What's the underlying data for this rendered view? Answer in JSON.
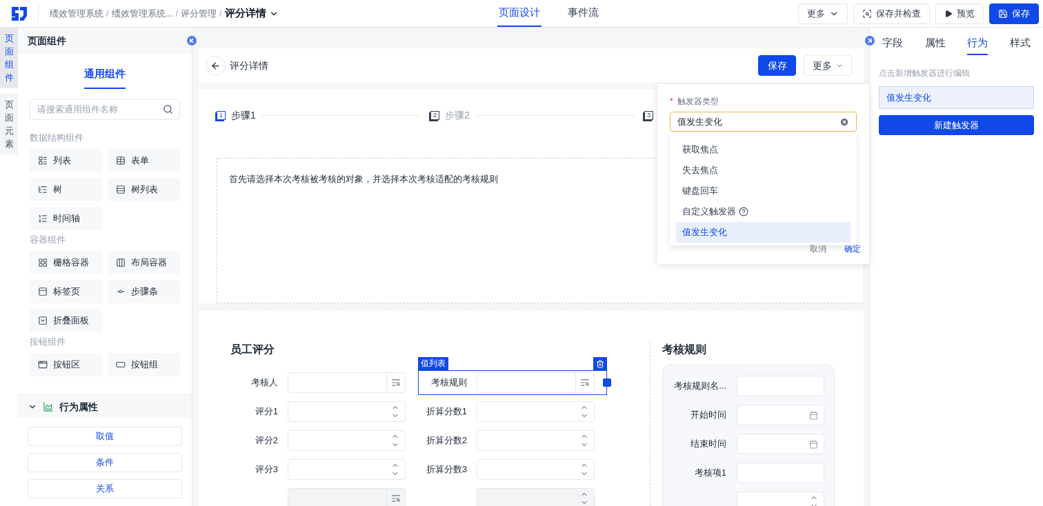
{
  "header": {
    "breadcrumb": [
      "绩效管理系统",
      "绩效管理系统...",
      "评分管理"
    ],
    "separator": "/",
    "current": "评分详情",
    "tabs": [
      {
        "label": "页面设计",
        "selected": true
      },
      {
        "label": "事件流",
        "selected": false
      }
    ],
    "actions": [
      {
        "label": "更多",
        "kind": "dropdown"
      },
      {
        "label": "保存并检查",
        "kind": "check"
      },
      {
        "label": "预览",
        "kind": "preview"
      },
      {
        "label": "保存",
        "kind": "primary"
      }
    ]
  },
  "side_tabs": [
    {
      "label": "页面组件",
      "selected": true
    },
    {
      "label": "页面元素",
      "selected": false
    }
  ],
  "component_panel": {
    "title": "页面组件",
    "tab": "通用组件",
    "search_placeholder": "请搜索通用组件名称",
    "groups": [
      {
        "title": "数据结构组件",
        "items": [
          {
            "label": "列表",
            "kind": "list"
          },
          {
            "label": "表单",
            "kind": "form"
          },
          {
            "label": "树",
            "kind": "tree"
          },
          {
            "label": "树列表",
            "kind": "treelist"
          },
          {
            "label": "时间轴",
            "kind": "timeline"
          }
        ]
      },
      {
        "title": "容器组件",
        "items": [
          {
            "label": "栅格容器",
            "kind": "grid"
          },
          {
            "label": "布局容器",
            "kind": "layout"
          },
          {
            "label": "标签页",
            "kind": "tabs"
          },
          {
            "label": "步骤条",
            "kind": "steps"
          },
          {
            "label": "折叠面板",
            "kind": "collapse"
          }
        ]
      },
      {
        "title": "按钮组件",
        "items": [
          {
            "label": "按钮区",
            "kind": "buttonarea"
          },
          {
            "label": "按钮组",
            "kind": "buttongroup"
          }
        ]
      }
    ]
  },
  "behavior": {
    "title": "行为属性",
    "expanded": true,
    "buttons": [
      "取值",
      "条件",
      "关系"
    ]
  },
  "canvas": {
    "title": "评分详情",
    "buttons": [
      {
        "label": "保存",
        "kind": "primary"
      },
      {
        "label": "更多",
        "kind": "dropdown"
      }
    ],
    "steps": [
      {
        "number": "1",
        "label": "步骤1",
        "selected": true
      },
      {
        "number": "2",
        "label": "步骤2",
        "selected": false
      },
      {
        "number": "3",
        "selected": false
      }
    ],
    "instruction": "首先请选择本次考核被考核的对象，并选择本次考核适配的考核规则",
    "form": {
      "title": "员工评分",
      "selection_tag": "值列表",
      "fields": [
        {
          "label": "考核人",
          "kind": "lookup",
          "selected": false,
          "disabled": false
        },
        {
          "label": "考核规则",
          "kind": "lookup",
          "selected": true,
          "disabled": false
        },
        {
          "label": "评分1",
          "kind": "number",
          "selected": false,
          "disabled": false
        },
        {
          "label": "折算分数1",
          "kind": "number",
          "selected": false,
          "disabled": false
        },
        {
          "label": "评分2",
          "kind": "number",
          "selected": false,
          "disabled": false
        },
        {
          "label": "折算分数2",
          "kind": "number",
          "selected": false,
          "disabled": false
        },
        {
          "label": "评分3",
          "kind": "number",
          "selected": false,
          "disabled": false
        },
        {
          "label": "折算分数3",
          "kind": "number",
          "selected": false,
          "disabled": false
        },
        {
          "kind": "lookup",
          "selected": false,
          "disabled": true
        },
        {
          "kind": "number",
          "selected": false,
          "disabled": true
        }
      ]
    },
    "rule": {
      "title": "考核规则",
      "fields": [
        {
          "label": "考核规则名...",
          "kind": "text"
        },
        {
          "label": "开始时间",
          "kind": "date"
        },
        {
          "label": "结束时间",
          "kind": "date"
        },
        {
          "label": "考核项1",
          "kind": "text"
        },
        {
          "kind": "number"
        }
      ]
    }
  },
  "trigger_popover": {
    "required_mark": "*",
    "label": "触发器类型",
    "value": "值发生变化",
    "options": [
      {
        "label": "获取焦点",
        "selected": false,
        "help": false
      },
      {
        "label": "失去焦点",
        "selected": false,
        "help": false
      },
      {
        "label": "键盘回车",
        "selected": false,
        "help": false
      },
      {
        "label": "自定义触发器",
        "selected": false,
        "help": true
      },
      {
        "label": "值发生变化",
        "selected": true,
        "help": false
      }
    ],
    "cancel": "取消",
    "confirm": "确定"
  },
  "right_panel": {
    "tabs": [
      {
        "label": "字段",
        "selected": false
      },
      {
        "label": "属性",
        "selected": false
      },
      {
        "label": "行为",
        "selected": true
      },
      {
        "label": "样式",
        "selected": false
      }
    ],
    "hint": "点击新增触发器进行编辑",
    "triggers": [
      {
        "label": "值发生变化"
      }
    ],
    "new_button": "新建触发器"
  }
}
